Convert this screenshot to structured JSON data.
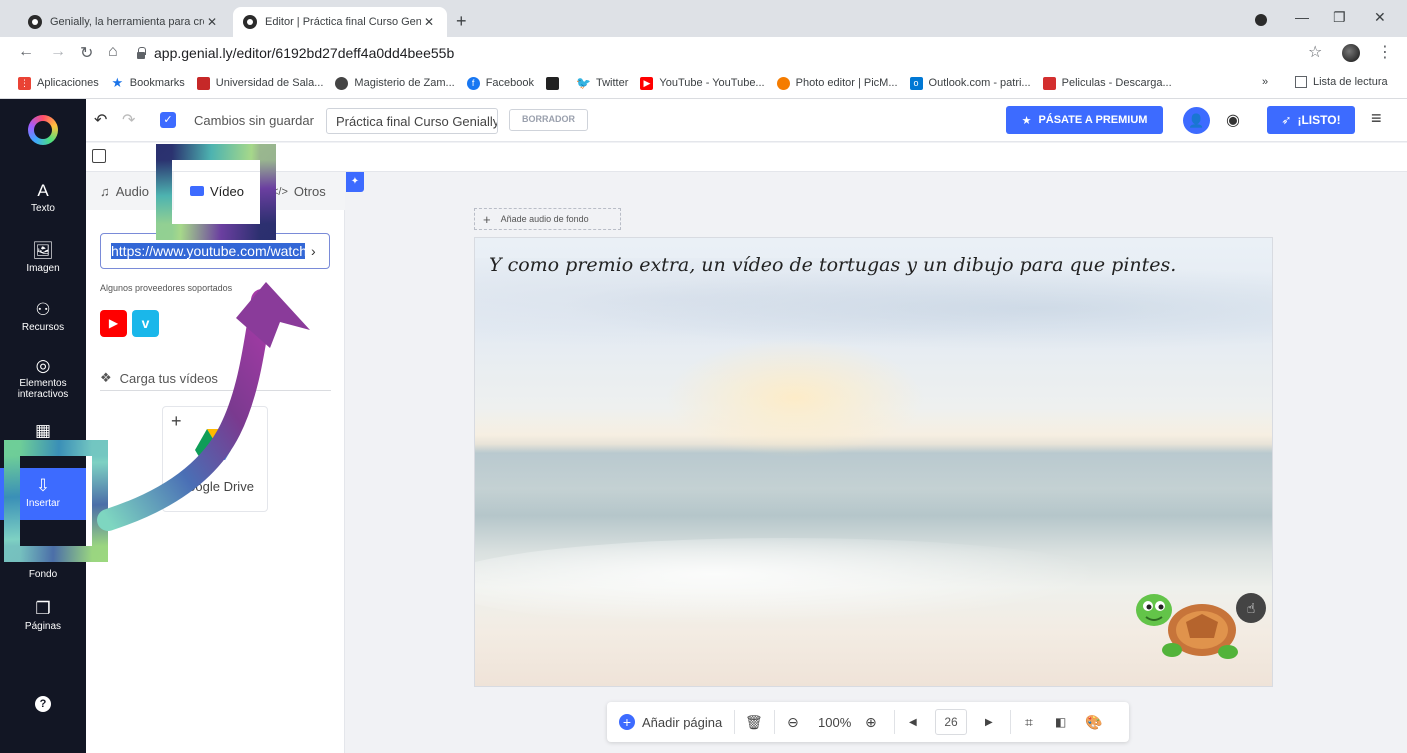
{
  "browser": {
    "tabs": [
      {
        "title": "Genially, la herramienta para cre",
        "active": false
      },
      {
        "title": "Editor | Práctica final Curso Genia",
        "active": true
      }
    ],
    "url": "app.genial.ly/editor/6192bd27deff4a0dd4bee55b",
    "bookmarks": [
      {
        "label": "Aplicaciones",
        "icon": "apps-grid-icon",
        "color": "#ea4335"
      },
      {
        "label": "Bookmarks",
        "icon": "star-icon",
        "color": "#1a73e8"
      },
      {
        "label": "Universidad de Sala...",
        "icon": "usal-icon",
        "color": "#c62828"
      },
      {
        "label": "Magisterio de Zam...",
        "icon": "globe-icon",
        "color": "#444444"
      },
      {
        "label": "Facebook",
        "icon": "facebook-icon",
        "color": "#1877f2"
      },
      {
        "label": "",
        "icon": "bookmark-dark-icon",
        "color": "#222222"
      },
      {
        "label": "Twitter",
        "icon": "twitter-icon",
        "color": "#1da1f2"
      },
      {
        "label": "YouTube - YouTube...",
        "icon": "youtube-icon",
        "color": "#ff0000"
      },
      {
        "label": "Photo editor | PicM...",
        "icon": "picmonkey-icon",
        "color": "#f57c00"
      },
      {
        "label": "Outlook.com - patri...",
        "icon": "outlook-icon",
        "color": "#0078d4"
      },
      {
        "label": "Peliculas - Descarga...",
        "icon": "movies-icon",
        "color": "#d32f2f"
      }
    ],
    "bookmarks_more": "»",
    "reading_list": "Lista de lectura"
  },
  "sidebar": {
    "items": [
      {
        "label": "Texto",
        "icon": "A"
      },
      {
        "label": "Imagen",
        "icon": "🖼"
      },
      {
        "label": "Recursos",
        "icon": "⚇"
      },
      {
        "label": "Elementos interactivos",
        "icon": "◎"
      },
      {
        "label": "",
        "icon": "▦"
      },
      {
        "label": "Insertar",
        "icon": "⇩"
      },
      {
        "label": "Fondo",
        "icon": "▭"
      },
      {
        "label": "Páginas",
        "icon": "❐"
      },
      {
        "label": "",
        "icon": "?"
      }
    ]
  },
  "topbar": {
    "status": "Cambios sin guardar",
    "project_name": "Práctica final Curso Genially",
    "draft_badge": "BORRADOR",
    "premium_button": "PÁSATE A PREMIUM",
    "ready_button": "¡LISTO!"
  },
  "insert_panel": {
    "tabs": [
      {
        "label": "Audio"
      },
      {
        "label": "Vídeo"
      },
      {
        "label": "Otros"
      }
    ],
    "url_value": "https://www.youtube.com/watch",
    "providers_label": "Algunos proveedores soportados",
    "upload_label": "Carga tus vídeos",
    "gdrive_label": "Google Drive"
  },
  "editor": {
    "add_audio": "Añade audio de fondo",
    "slide_text": "Y como premio extra, un vídeo de tortugas y un dibujo para que pintes.",
    "add_page": "Añadir página",
    "zoom": "100%",
    "page_number": "26"
  },
  "colors": {
    "accent": "#3d6bff",
    "sidebar_bg": "#121624",
    "youtube": "#ff0000",
    "vimeo": "#1ab7ea"
  }
}
